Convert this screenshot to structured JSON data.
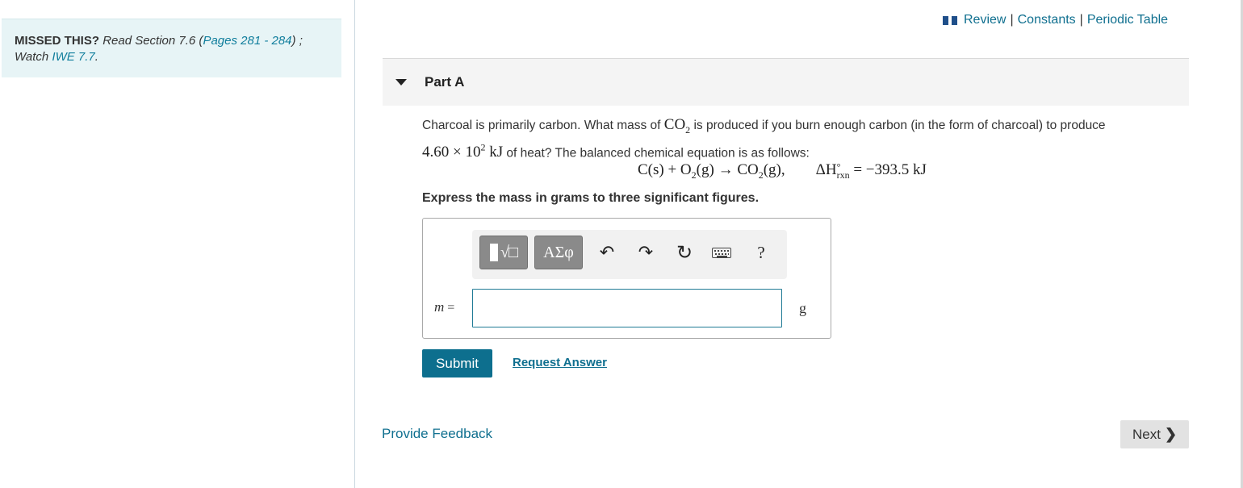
{
  "hint": {
    "missed_label": "MISSED THIS?",
    "read_text": "Read Section 7.6 (",
    "pages_link": "Pages 281 - 284",
    "close_text": ") ;",
    "watch_text": "Watch ",
    "iwe_link": "IWE 7.7",
    "period": "."
  },
  "toplinks": {
    "review": "Review",
    "constants": "Constants",
    "periodic_table": "Periodic Table",
    "separator": "|"
  },
  "part": {
    "title": "Part A"
  },
  "question": {
    "text_1": "Charcoal is primarily carbon. What mass of ",
    "co2_base": "CO",
    "co2_sub": "2",
    "text_2": " is produced if you burn enough carbon (in the form of charcoal) to produce",
    "heat_value": "4.60 × 10",
    "heat_exp": "2",
    "heat_unit": " kJ",
    "text_3": " of heat? The balanced chemical equation is as follows:"
  },
  "equation": {
    "c": "C(s) + O",
    "o2_sub": "2",
    "mid": "(g) → CO",
    "co2_sub": "2",
    "end": "(g),",
    "dh": "ΔH",
    "dh_sup": "°",
    "dh_sub": "rxn",
    "dh_value": " = −393.5 kJ"
  },
  "instruction": "Express the mass in grams to three significant figures.",
  "answer": {
    "toolbar": {
      "template_label": "√□",
      "greek_label": "ΑΣφ",
      "undo_glyph": "↶",
      "redo_glyph": "↷",
      "reset_glyph": "↻",
      "help_glyph": "?"
    },
    "variable": "m",
    "equals": " =",
    "value": "",
    "unit": "g"
  },
  "actions": {
    "submit": "Submit",
    "request_answer": "Request Answer",
    "provide_feedback": "Provide Feedback",
    "next": "Next",
    "next_chevron": "❯"
  },
  "colors": {
    "accent": "#0d6f8e",
    "link": "#0f6f8f",
    "hint_bg": "#e7f4f6",
    "header_bg": "#f4f4f4"
  }
}
